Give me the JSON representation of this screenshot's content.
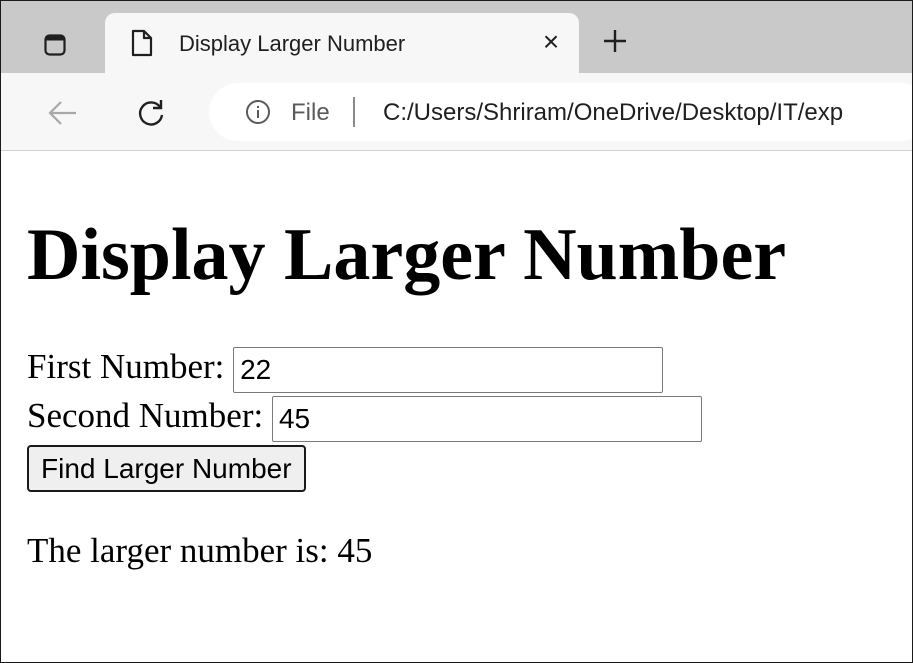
{
  "browser": {
    "tab_title": "Display Larger Number",
    "close_label": "×",
    "address": {
      "scheme_label": "File",
      "url": "C:/Users/Shriram/OneDrive/Desktop/IT/exp"
    }
  },
  "page": {
    "heading": "Display Larger Number",
    "first_label": "First Number:",
    "first_value": "22",
    "second_label": "Second Number:",
    "second_value": "45",
    "button_label": "Find Larger Number",
    "result_text": "The larger number is: 45"
  }
}
